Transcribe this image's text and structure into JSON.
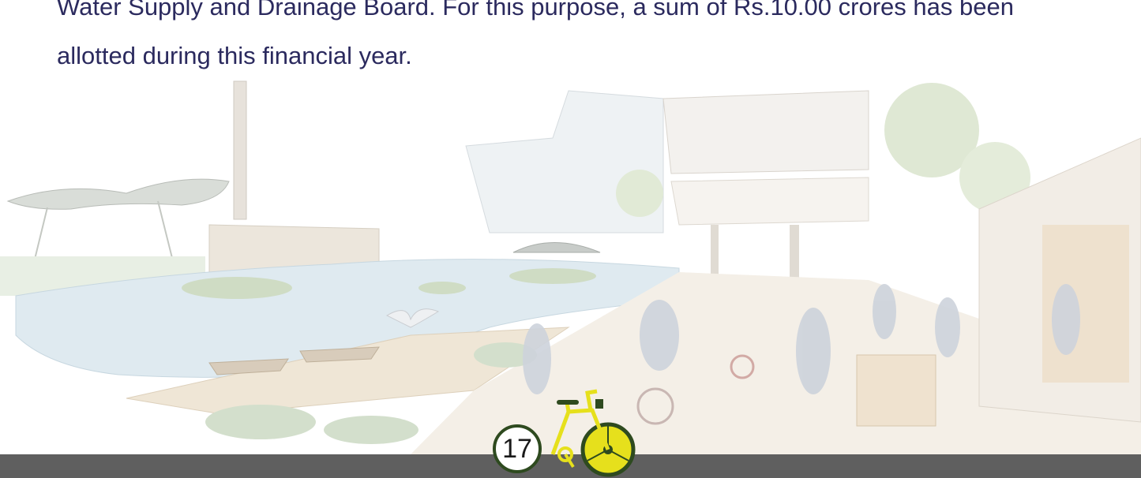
{
  "body_text": {
    "line1": "Water Supply and Drainage Board. For this purpose, a sum of Rs.10.00 crores has been",
    "line2": "allotted during this financial year."
  },
  "page": {
    "number": "17"
  },
  "colors": {
    "text": "#2b2a5e",
    "footer_bar": "#5f5f5f",
    "badge_border": "#2e4a1f",
    "bicycle_frame": "#e6e01c"
  },
  "illustration": {
    "subject": "waterfront-urban-scene-icon"
  },
  "icons": {
    "page_ornament": "bicycle-icon"
  }
}
